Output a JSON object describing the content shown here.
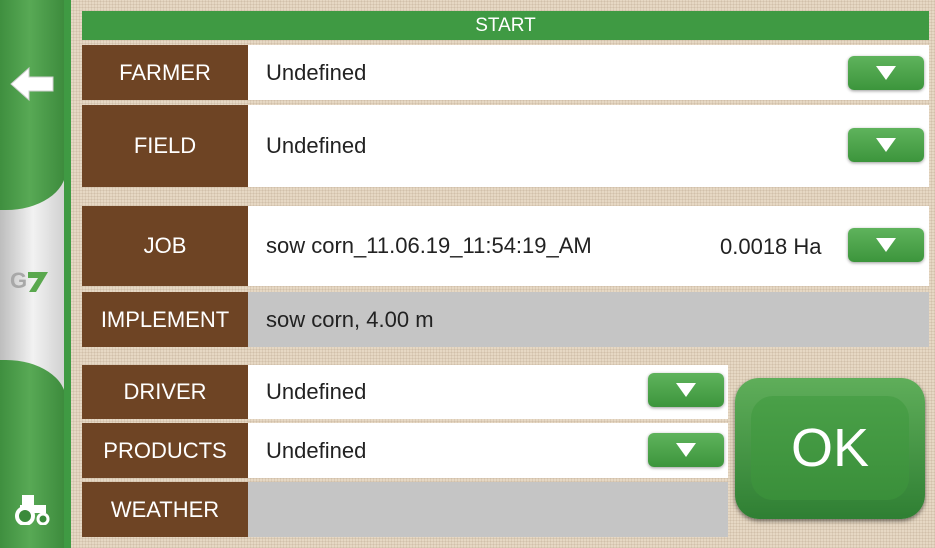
{
  "header": {
    "title": "START"
  },
  "rows": {
    "farmer": {
      "label": "FARMER",
      "value": "Undefined"
    },
    "field": {
      "label": "FIELD",
      "value": "Undefined"
    },
    "job": {
      "label": "JOB",
      "value": "sow corn_11.06.19_11:54:19_AM",
      "area": "0.0018 Ha"
    },
    "implement": {
      "label": "IMPLEMENT",
      "value": "sow corn, 4.00 m"
    },
    "driver": {
      "label": "DRIVER",
      "value": "Undefined"
    },
    "products": {
      "label": "PRODUCTS",
      "value": "Undefined"
    },
    "weather": {
      "label": "WEATHER",
      "value": ""
    }
  },
  "ok_button": {
    "label": "OK"
  },
  "sidebar": {
    "logo": "G7",
    "icons": [
      "back-arrow-icon",
      "tractor-icon"
    ]
  },
  "colors": {
    "green": "#3f9a43",
    "brown": "#6e4424",
    "gray_value": "#c5c5c5"
  }
}
